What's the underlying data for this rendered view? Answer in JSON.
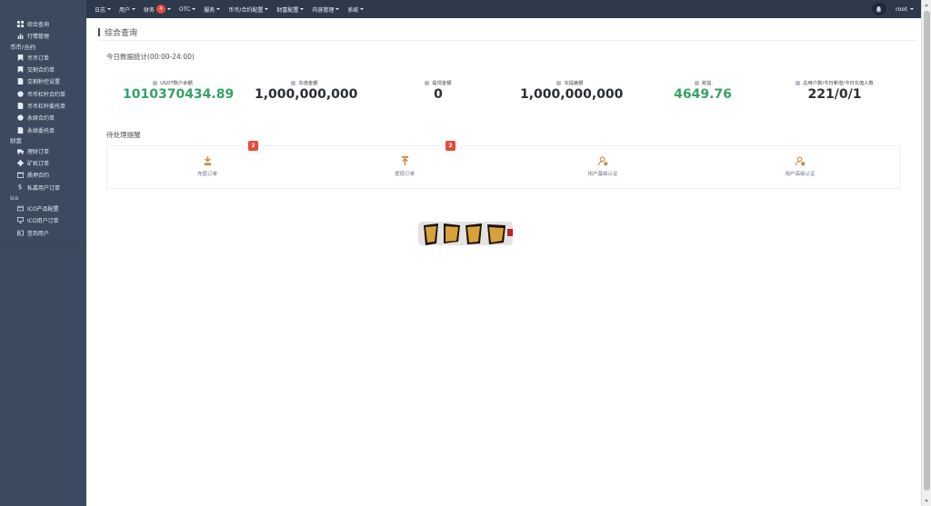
{
  "sidebar": {
    "top_items": [
      {
        "label": "综合查询",
        "icon": "grid-icon"
      },
      {
        "label": "行情管理",
        "icon": "chart-icon"
      }
    ],
    "groups": [
      {
        "title": "币币/合约",
        "items": [
          {
            "label": "币币订单",
            "icon": "bookmark-icon"
          },
          {
            "label": "交割合约单",
            "icon": "bookmark-icon"
          },
          {
            "label": "交割秒控设置",
            "icon": "document-icon"
          },
          {
            "label": "币币杠杆合约单",
            "icon": "clock-icon"
          },
          {
            "label": "币币杠杆委托单",
            "icon": "document-icon"
          },
          {
            "label": "永续合约单",
            "icon": "clock-icon"
          },
          {
            "label": "永续委托单",
            "icon": "document-icon"
          }
        ]
      },
      {
        "title": "财富",
        "items": [
          {
            "label": "理财订单",
            "icon": "truck-icon"
          },
          {
            "label": "矿机订单",
            "icon": "gear-icon"
          },
          {
            "label": "质押合约",
            "icon": "calendar-icon"
          },
          {
            "label": "私募用户订单",
            "icon": "dollar-icon"
          }
        ]
      },
      {
        "title": "ico",
        "items": [
          {
            "label": "ICO产品配置",
            "icon": "layers-icon"
          },
          {
            "label": "ICO用户订单",
            "icon": "monitor-icon"
          },
          {
            "label": "签到用户",
            "icon": "card-icon"
          }
        ]
      }
    ]
  },
  "topbar": {
    "nav": [
      {
        "label": "日志",
        "caret": true
      },
      {
        "label": "用户",
        "caret": true
      },
      {
        "label": "财务",
        "badge": "4",
        "caret": true
      },
      {
        "label": "OTC",
        "caret": true
      },
      {
        "label": "服务",
        "caret": true
      },
      {
        "label": "币币/合约配置",
        "caret": true
      },
      {
        "label": "财富配置",
        "caret": true
      },
      {
        "label": "内容管理",
        "caret": true
      },
      {
        "label": "系统",
        "caret": true
      }
    ],
    "user": "root"
  },
  "main": {
    "page_title": "综合查询",
    "stats_title": "今日数据统计(00:00-24:00)",
    "stats": [
      {
        "label": "USDT账户余额",
        "value": "1010370434.89",
        "color": "#36a165"
      },
      {
        "label": "充值金额",
        "value": "1,000,000,000",
        "color": "#2a2f36"
      },
      {
        "label": "提现金额",
        "value": "0",
        "color": "#2a2f36"
      },
      {
        "label": "充提差额",
        "value": "1,000,000,000",
        "color": "#2a2f36"
      },
      {
        "label": "收益",
        "value": "4649.76",
        "color": "#36a165"
      },
      {
        "label": "总用户数/今日新增/今日充值人数",
        "value": "221/0/1",
        "color": "#2a2f36"
      }
    ],
    "pending_title": "待处理提醒",
    "pending": [
      {
        "label": "充值订单",
        "badge": "2",
        "icon": "deposit-icon"
      },
      {
        "label": "提现订单",
        "badge": "2",
        "icon": "withdraw-icon"
      },
      {
        "label": "用户基础认证",
        "badge": "",
        "icon": "user-check-icon"
      },
      {
        "label": "用户高级认证",
        "badge": "",
        "icon": "user-check-icon"
      }
    ]
  },
  "colors": {
    "sidebar_bg": "#3c4a5f",
    "topbar_bg": "#2e3a4c",
    "green": "#36a165",
    "badge_red": "#e84a3c"
  }
}
